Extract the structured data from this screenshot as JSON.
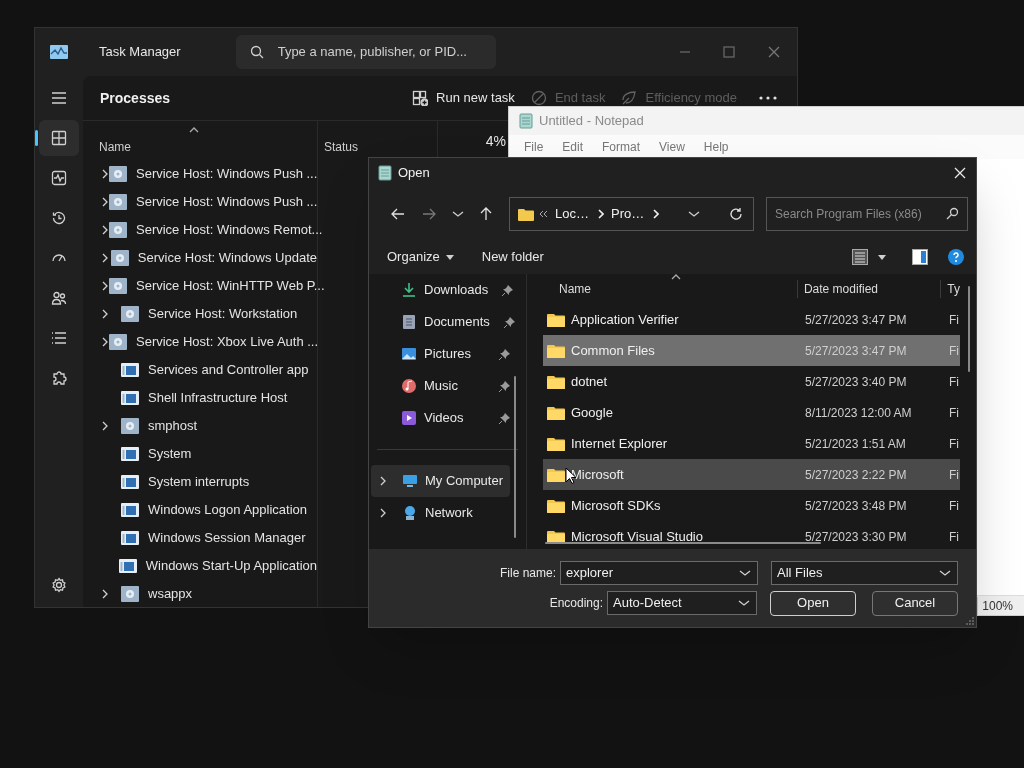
{
  "task_manager": {
    "title": "Task Manager",
    "search": {
      "placeholder": "Type a name, publisher, or PID..."
    },
    "sidebar_items": [
      {
        "selected": false
      },
      {
        "selected": true
      },
      {
        "selected": false
      },
      {
        "selected": false
      },
      {
        "selected": false
      },
      {
        "selected": false
      },
      {
        "selected": false
      },
      {
        "selected": false
      }
    ],
    "page_title": "Processes",
    "toolbar": [
      {
        "label": "Run new task",
        "disabled": false
      },
      {
        "label": "End task",
        "disabled": true
      },
      {
        "label": "Efficiency mode",
        "disabled": true
      }
    ],
    "columns": {
      "name": "Name",
      "status": "Status",
      "cpu": "4%"
    },
    "rows": [
      {
        "name": "Service Host: Windows Push ...",
        "expandable": true,
        "kind": "service"
      },
      {
        "name": "Service Host: Windows Push ...",
        "expandable": true,
        "kind": "service"
      },
      {
        "name": "Service Host: Windows Remot...",
        "expandable": true,
        "kind": "service"
      },
      {
        "name": "Service Host: Windows Update",
        "expandable": true,
        "kind": "service"
      },
      {
        "name": "Service Host: WinHTTP Web P...",
        "expandable": true,
        "kind": "service"
      },
      {
        "name": "Service Host: Workstation",
        "expandable": true,
        "kind": "service"
      },
      {
        "name": "Service Host: Xbox Live Auth ...",
        "expandable": true,
        "kind": "service"
      },
      {
        "name": "Services and Controller app",
        "expandable": false,
        "kind": "app"
      },
      {
        "name": "Shell Infrastructure Host",
        "expandable": false,
        "kind": "app"
      },
      {
        "name": "smphost",
        "expandable": true,
        "kind": "service"
      },
      {
        "name": "System",
        "expandable": false,
        "kind": "app"
      },
      {
        "name": "System interrupts",
        "expandable": false,
        "kind": "app"
      },
      {
        "name": "Windows Logon Application",
        "expandable": false,
        "kind": "app"
      },
      {
        "name": "Windows Session Manager",
        "expandable": false,
        "kind": "app"
      },
      {
        "name": "Windows Start-Up Application",
        "expandable": false,
        "kind": "app"
      },
      {
        "name": "wsappx",
        "expandable": true,
        "kind": "service"
      }
    ]
  },
  "notepad": {
    "title": "Untitled - Notepad",
    "menu": [
      "File",
      "Edit",
      "Format",
      "View",
      "Help"
    ],
    "zoom": "100%"
  },
  "open_dialog": {
    "title": "Open",
    "breadcrumb": [
      "Loc…",
      "Pro…"
    ],
    "search": {
      "placeholder": "Search Program Files (x86)"
    },
    "toolbar": {
      "organize": "Organize",
      "new_folder": "New folder"
    },
    "quick_access": [
      {
        "label": "Downloads",
        "pinned": true
      },
      {
        "label": "Documents",
        "pinned": true
      },
      {
        "label": "Pictures",
        "pinned": true
      },
      {
        "label": "Music",
        "pinned": true
      },
      {
        "label": "Videos",
        "pinned": true
      }
    ],
    "locations": [
      {
        "label": "My Computer",
        "selected": true
      },
      {
        "label": "Network",
        "selected": false
      }
    ],
    "columns": {
      "name": "Name",
      "date": "Date modified",
      "type": "Ty"
    },
    "files": [
      {
        "name": "Application Verifier",
        "date": "5/27/2023 3:47 PM",
        "type": "Fi",
        "selected": false,
        "hovered": false
      },
      {
        "name": "Common Files",
        "date": "5/27/2023 3:47 PM",
        "type": "Fi",
        "selected": true,
        "hovered": false
      },
      {
        "name": "dotnet",
        "date": "5/27/2023 3:40 PM",
        "type": "Fi",
        "selected": false,
        "hovered": false
      },
      {
        "name": "Google",
        "date": "8/11/2023 12:00 AM",
        "type": "Fi",
        "selected": false,
        "hovered": false
      },
      {
        "name": "Internet Explorer",
        "date": "5/21/2023 1:51 AM",
        "type": "Fi",
        "selected": false,
        "hovered": false
      },
      {
        "name": "Microsoft",
        "date": "5/27/2023 2:22 PM",
        "type": "Fi",
        "selected": false,
        "hovered": true
      },
      {
        "name": "Microsoft SDKs",
        "date": "5/27/2023 3:48 PM",
        "type": "Fi",
        "selected": false,
        "hovered": false
      },
      {
        "name": "Microsoft Visual Studio",
        "date": "5/27/2023 3:30 PM",
        "type": "Fi",
        "selected": false,
        "hovered": false
      }
    ],
    "file_name": {
      "label": "File name:",
      "value": "explorer"
    },
    "filter": {
      "value": "All Files"
    },
    "encoding": {
      "label": "Encoding:",
      "value": "Auto-Detect"
    },
    "buttons": [
      "Open",
      "Cancel"
    ]
  }
}
